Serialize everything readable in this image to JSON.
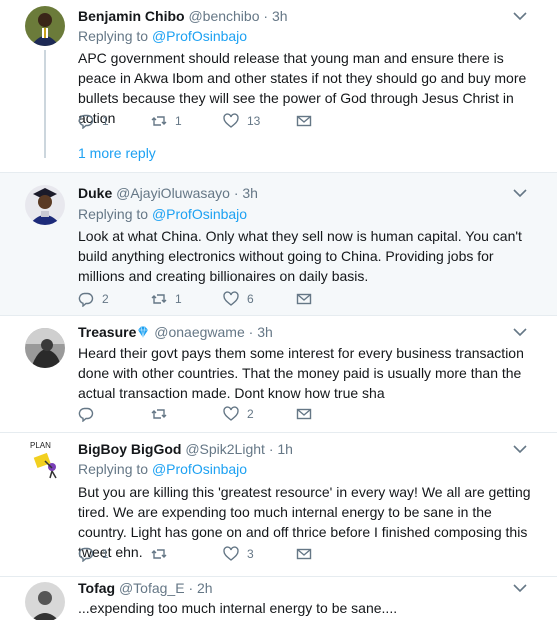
{
  "tweets": [
    {
      "name": "Benjamin Chibo",
      "handle": "@benchibo",
      "time": "3h",
      "replying_label": "Replying to",
      "replying_to": "@ProfOsinbajo",
      "text": "APC government should release that young man and ensure there is peace in Akwa Ibom and other states if not they should go and buy more bullets because they will see the power of God through Jesus Christ in action",
      "replies": "1",
      "retweets": "1",
      "likes": "13",
      "more_replies": "1 more reply"
    },
    {
      "name": "Duke",
      "handle": "@AjayiOluwasayo",
      "time": "3h",
      "replying_label": "Replying to",
      "replying_to": "@ProfOsinbajo",
      "text": "Look at what China. Only what they sell now is human capital. You can't build anything electronics without going to China. Providing jobs for millions and creating billionaires on daily basis.",
      "replies": "2",
      "retweets": "1",
      "likes": "6"
    },
    {
      "name": "Treasure",
      "handle": "@onaegwame",
      "time": "3h",
      "text": "Heard their govt pays them some interest for every business transaction done with other countries. That the money paid is usually more than the actual transaction made. Dont know how true sha",
      "replies": "",
      "retweets": "",
      "likes": "2"
    },
    {
      "name": "BigBoy BigGod",
      "handle": "@Spik2Light",
      "time": "1h",
      "replying_label": "Replying to",
      "replying_to": "@ProfOsinbajo",
      "text": "But you are killing this 'greatest resource' in every way! We all are getting tired. We are expending too much internal energy to be sane in the country. Light has gone on and off thrice before I finished composing this tweet ehn.",
      "replies": "1",
      "retweets": "",
      "likes": "3",
      "avatar_text": "PLAN"
    },
    {
      "name": "Tofag",
      "handle": "@Tofag_E",
      "time": "2h",
      "text": "...expending too much internal energy to be sane...."
    }
  ],
  "separator": "·",
  "colors": {
    "accent": "#1da1f2",
    "muted": "#657786",
    "verified": "#1da1f2",
    "like_active": "#e0245e"
  },
  "icons": [
    "reply-icon",
    "retweet-icon",
    "like-icon",
    "message-icon",
    "chevron-down-icon",
    "verified-badge-icon"
  ]
}
